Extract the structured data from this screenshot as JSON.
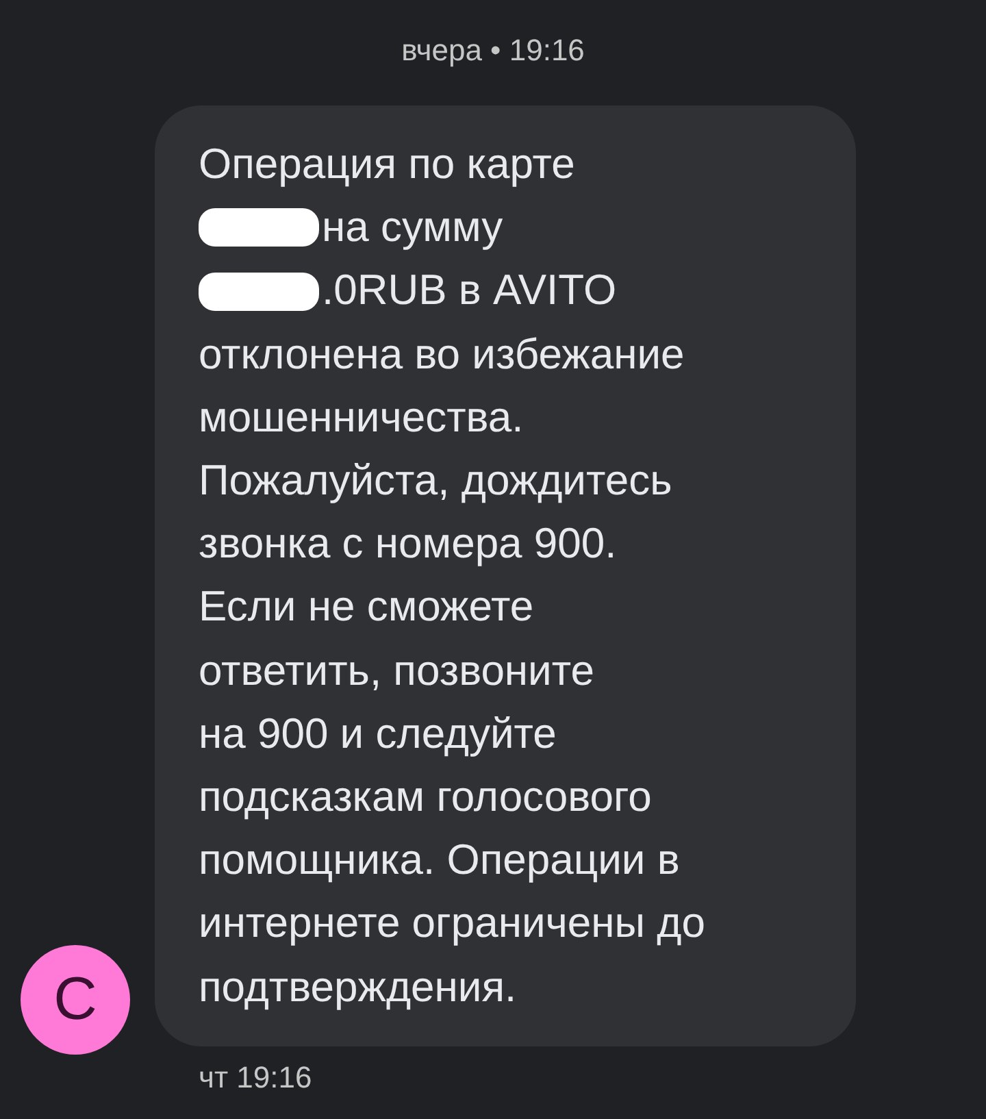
{
  "date_header": "вчера • 19:16",
  "message": {
    "lines": [
      {
        "redacted": false,
        "text": "Операция по карте"
      },
      {
        "redacted": true,
        "text": "на сумму"
      },
      {
        "redacted": true,
        "text": ".0RUB в AVITO"
      },
      {
        "redacted": false,
        "text": "отклонена во избежание"
      },
      {
        "redacted": false,
        "text": "мошенничества."
      },
      {
        "redacted": false,
        "text": "Пожалуйста, дождитесь"
      },
      {
        "redacted": false,
        "text": "звонка с номера 900."
      },
      {
        "redacted": false,
        "text": "Если не сможете"
      },
      {
        "redacted": false,
        "text": "ответить, позвоните"
      },
      {
        "redacted": false,
        "text": "на 900 и следуйте"
      },
      {
        "redacted": false,
        "text": "подсказкам голосового"
      },
      {
        "redacted": false,
        "text": "помощника. Операции в"
      },
      {
        "redacted": false,
        "text": "интернете ограничены до"
      },
      {
        "redacted": false,
        "text": "подтверждения."
      }
    ],
    "time": "чт 19:16"
  },
  "avatar": {
    "letter": "С",
    "color": "#ff79d7"
  }
}
